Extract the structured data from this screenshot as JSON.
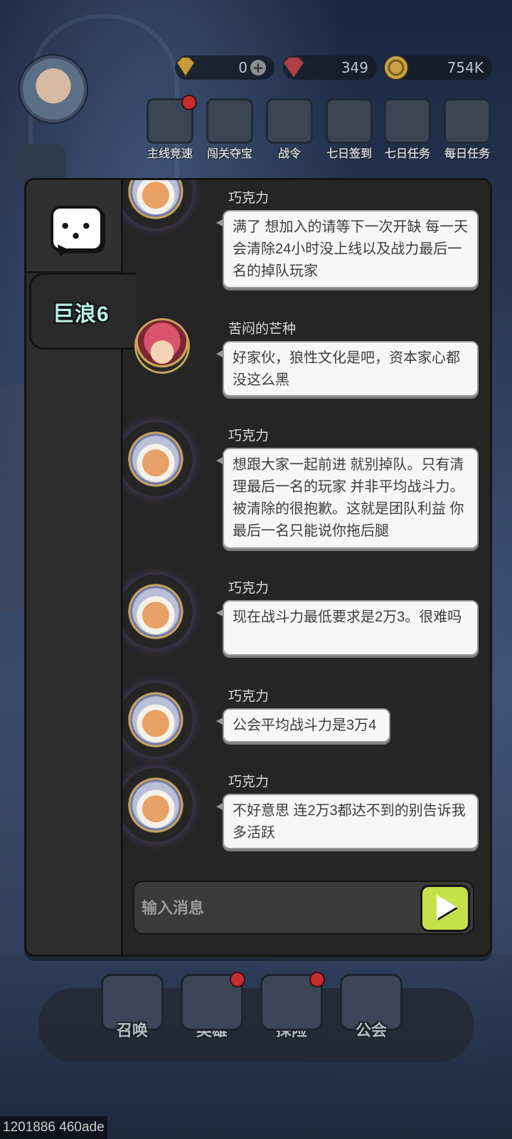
{
  "hud": {
    "currencies": [
      {
        "name": "gem",
        "value": "0",
        "has_plus": true
      },
      {
        "name": "ruby",
        "value": "349"
      },
      {
        "name": "coin",
        "value": "754K"
      }
    ],
    "quick_menu": [
      {
        "label": "主线竞速"
      },
      {
        "label": "闯关夺宝"
      },
      {
        "label": "战令"
      },
      {
        "label": "七日签到"
      },
      {
        "label": "七日任务"
      },
      {
        "label": "每日任务"
      }
    ]
  },
  "chat": {
    "channel_tab": "巨浪6",
    "messages": [
      {
        "name": "巧克力",
        "avatar": "tiger-avatar",
        "text": "满了 想加入的请等下一次开缺 每一天会清除24小时没上线以及战力最后一名的掉队玩家"
      },
      {
        "name": "苦闷的芒种",
        "avatar": "girl-avatar",
        "text": "好家伙，狼性文化是吧，资本家心都没这么黑"
      },
      {
        "name": "巧克力",
        "avatar": "tiger-avatar",
        "text": "想跟大家一起前进 就别掉队。只有清理最后一名的玩家 并非平均战斗力。被清除的很抱歉。这就是团队利益 你最后一名只能说你拖后腿"
      },
      {
        "name": "巧克力",
        "avatar": "tiger-avatar",
        "text": "现在战斗力最低要求是2万3。很难吗"
      },
      {
        "name": "巧克力",
        "avatar": "tiger-avatar",
        "text": "公会平均战斗力是3万4"
      },
      {
        "name": "巧克力",
        "avatar": "tiger-avatar",
        "text": "不好意思 连2万3都达不到的别告诉我多活跃"
      }
    ],
    "input_placeholder": "输入消息"
  },
  "bottom_nav": [
    {
      "label": "召唤"
    },
    {
      "label": "英雄"
    },
    {
      "label": "探险"
    },
    {
      "label": "公会"
    }
  ],
  "build_id": "1201886 460ade",
  "colors": {
    "panel_bg": "#252525",
    "bubble_bg": "#f7f7f7",
    "tab_text": "#b9f0e6",
    "send_button": "#c6e04a",
    "notification_dot": "#c62d2d"
  }
}
